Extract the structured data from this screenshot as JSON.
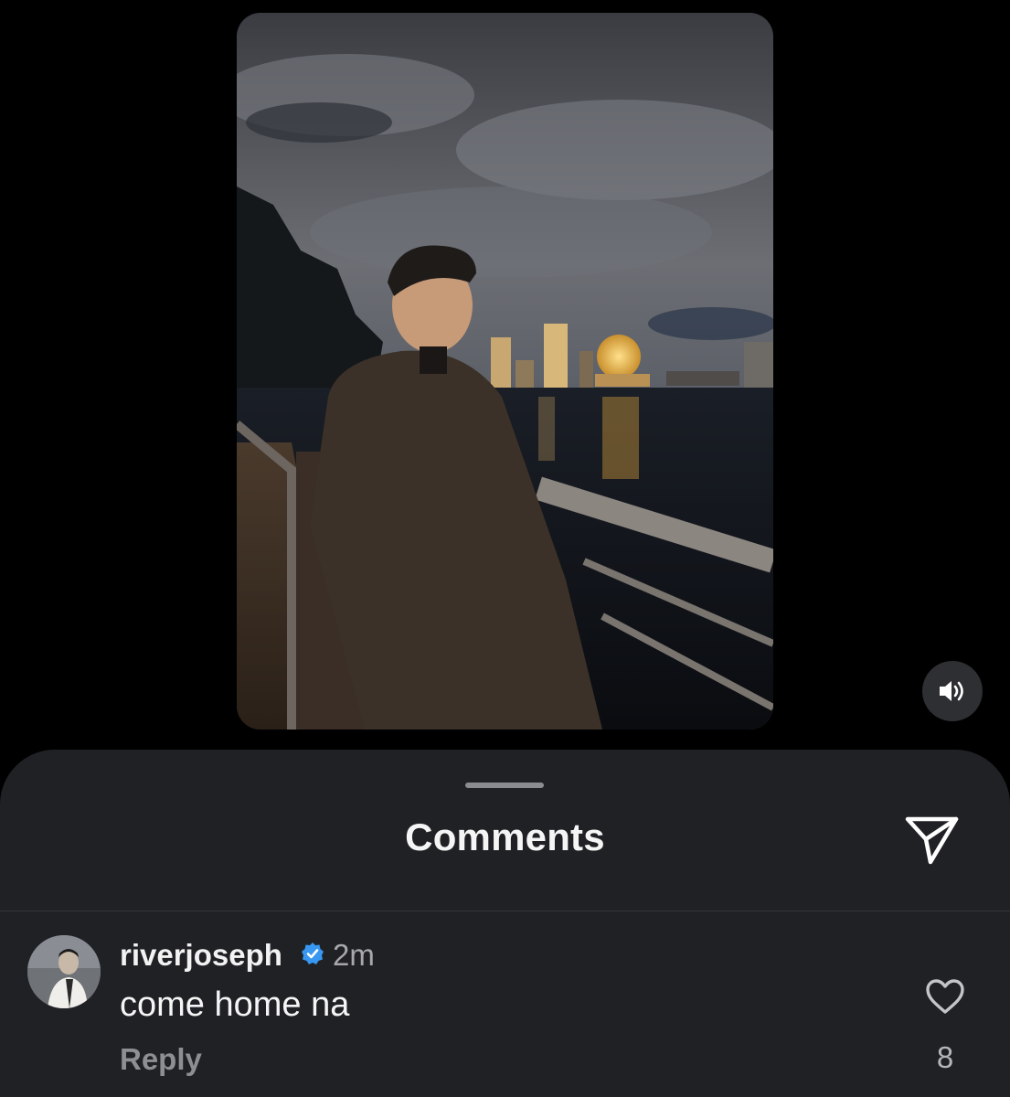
{
  "sheet": {
    "title": "Comments"
  },
  "comment": {
    "username": "riverjoseph",
    "time": "2m",
    "text": "come home na",
    "reply_label": "Reply",
    "like_count": "8"
  },
  "icons": {
    "sound": "speaker-volume-icon",
    "share": "paper-plane-icon",
    "verified": "verified-badge-icon",
    "like": "heart-outline-icon"
  },
  "colors": {
    "verified_blue": "#3897f0",
    "sheet_bg": "#1f2125"
  }
}
